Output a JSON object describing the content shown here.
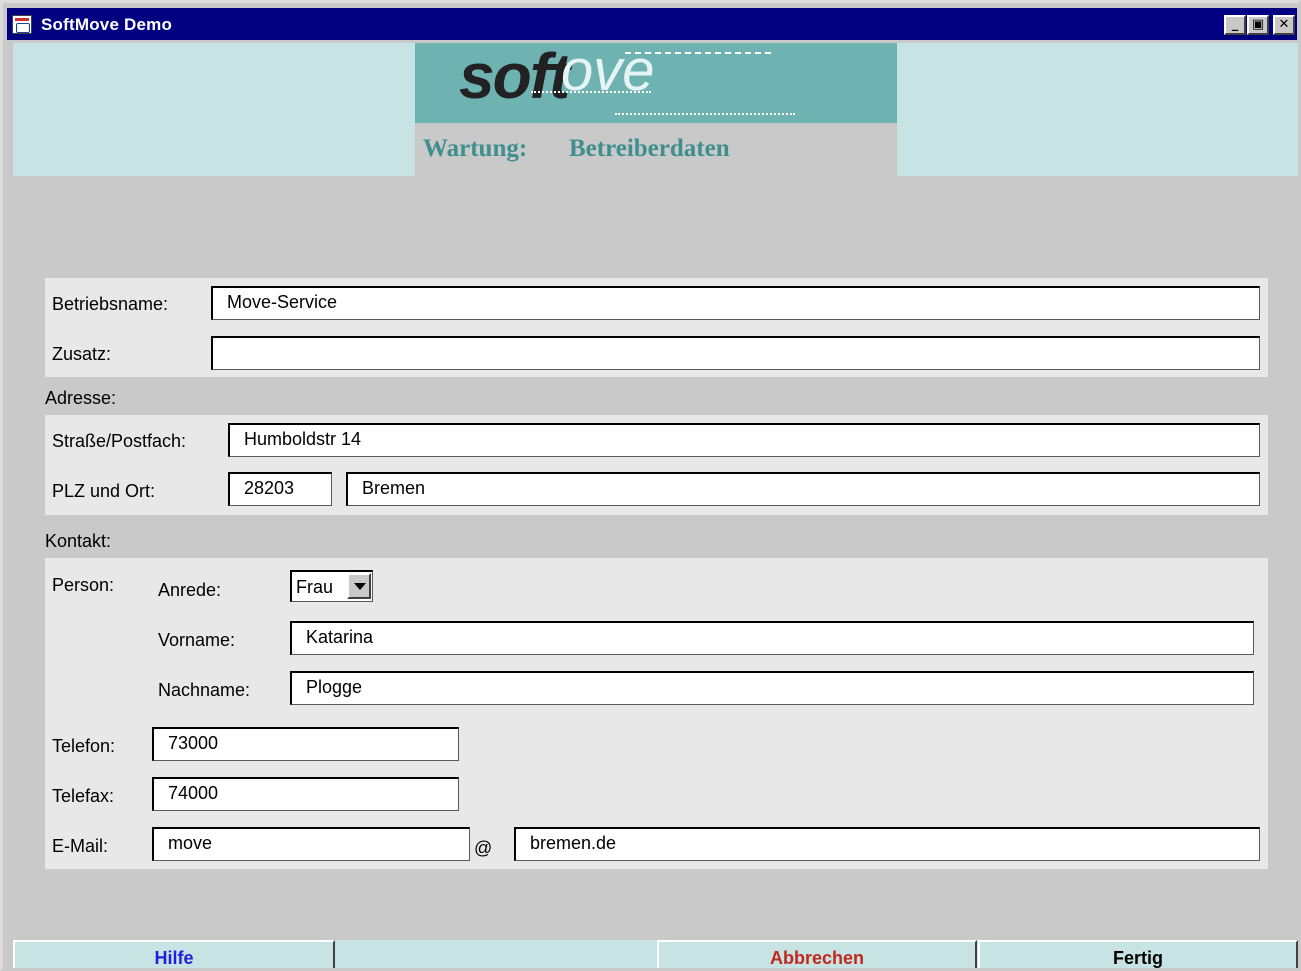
{
  "window": {
    "title": "SoftMove Demo",
    "controls": {
      "minimize": "_",
      "restore": "▣",
      "close": "✕"
    }
  },
  "logo": {
    "soft": "soft",
    "move": "ove"
  },
  "heading": {
    "section": "Wartung:",
    "page": "Betreiberdaten"
  },
  "betrieb": {
    "name_label": "Betriebsname:",
    "name_value": "Move-Service",
    "zusatz_label": "Zusatz:",
    "zusatz_value": ""
  },
  "adresse": {
    "label": "Adresse:",
    "strasse_label": "Straße/Postfach:",
    "strasse_value": "Humboldstr 14",
    "plz_label": "PLZ und Ort:",
    "plz_value": "28203",
    "ort_value": "Bremen"
  },
  "kontakt": {
    "label": "Kontakt:",
    "person_label": "Person:",
    "anrede_label": "Anrede:",
    "anrede_value": "Frau",
    "vorname_label": "Vorname:",
    "vorname_value": "Katarina",
    "nachname_label": "Nachname:",
    "nachname_value": "Plogge",
    "telefon_label": "Telefon:",
    "telefon_value": "73000",
    "telefax_label": "Telefax:",
    "telefax_value": "74000",
    "email_label": "E-Mail:",
    "email_user": "move",
    "email_at": "@",
    "email_domain": "bremen.de"
  },
  "buttons": {
    "help": "Hilfe",
    "cancel": "Abbrechen",
    "done": "Fertig"
  },
  "colors": {
    "titlebar": "#000080",
    "header": "#c8e3e3",
    "heading": "#3f8f8f",
    "help": "#1f1fdd",
    "cancel": "#c0281e",
    "done": "#000000"
  }
}
